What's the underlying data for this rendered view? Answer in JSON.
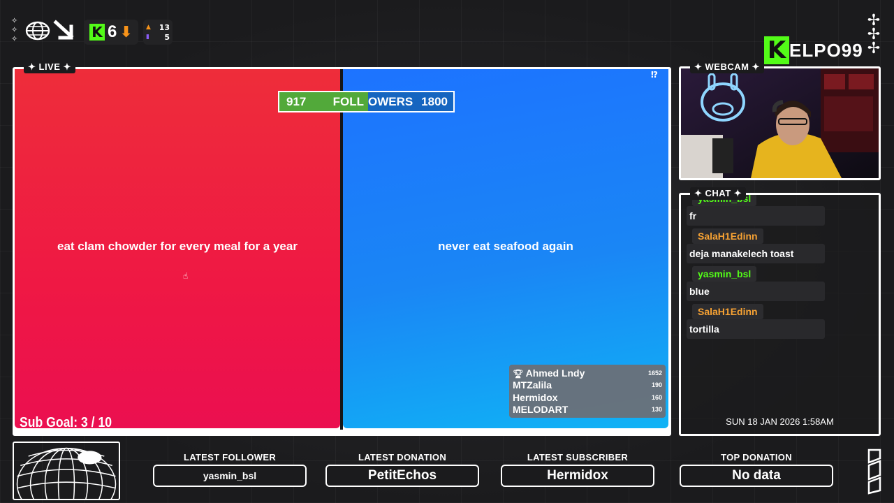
{
  "hud": {
    "kick_rank": "6",
    "stat_top": "13",
    "stat_bottom": "5"
  },
  "tags": {
    "live": "✦ LIVE ✦",
    "webcam": "✦ WEBCAM ✦",
    "chat": "✦ CHAT ✦"
  },
  "brand": {
    "logo_letter": "K",
    "name": "ELPO99"
  },
  "followers_bar": {
    "current": "917",
    "label": "FOLLOWERS",
    "goal": "1800",
    "progress": 0.51
  },
  "poll": {
    "option_a": "eat clam chowder for every meal for a year",
    "option_b": "never eat seafood again",
    "icon": "⁉"
  },
  "leaderboard": [
    {
      "name": "Ahmed Lndy",
      "value": "1652"
    },
    {
      "name": "MTZalila",
      "value": "190"
    },
    {
      "name": "Hermidox",
      "value": "160"
    },
    {
      "name": "MELODART",
      "value": "130"
    }
  ],
  "sub_goal": "Sub Goal:  3 / 10",
  "chat": [
    {
      "user": "yasmin_bsl",
      "color": "#53fc18",
      "message": "fr"
    },
    {
      "user": "SalaH1Edinn",
      "color": "#f7a233",
      "message": "deja manakelech toast"
    },
    {
      "user": "yasmin_bsl",
      "color": "#53fc18",
      "message": "blue"
    },
    {
      "user": "SalaH1Edinn",
      "color": "#f7a233",
      "message": "tortilla"
    }
  ],
  "datetime": "SUN 18 JAN 2026 1:58AM",
  "bottom": {
    "latest_follower_title": "LATEST FOLLOWER",
    "latest_follower": "yasmin_bsl",
    "latest_donation_title": "LATEST DONATION",
    "latest_donation": "PetitEchos",
    "latest_subscriber_title": "LATEST SUBSCRIBER",
    "latest_subscriber": "Hermidox",
    "top_donation_title": "TOP DONATION",
    "top_donation": "No data"
  }
}
